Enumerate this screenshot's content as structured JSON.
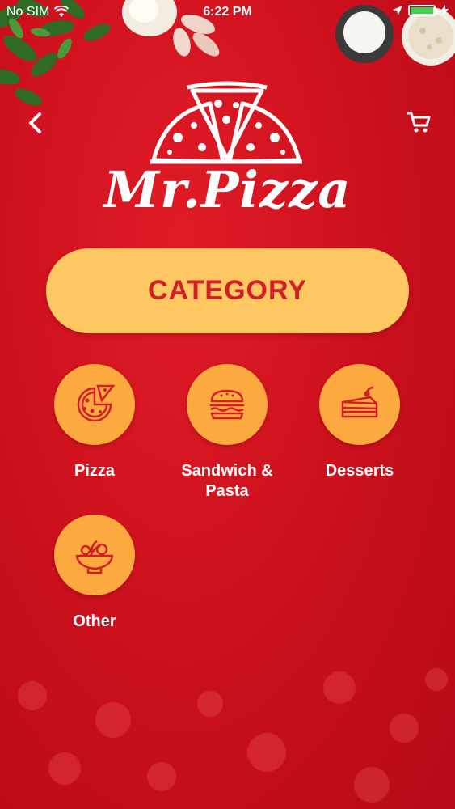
{
  "status_bar": {
    "carrier": "No SIM",
    "time": "6:22 PM",
    "battery_level": 1.0
  },
  "header": {
    "brand": "Mr.Pizza",
    "back_icon": "chevron-left-icon",
    "cart_icon": "cart-icon"
  },
  "category_banner": {
    "label": "CATEGORY"
  },
  "categories": [
    {
      "label": "Pizza",
      "icon": "pizza-icon"
    },
    {
      "label": "Sandwich &\nPasta",
      "icon": "burger-icon"
    },
    {
      "label": "Desserts",
      "icon": "cake-slice-icon"
    },
    {
      "label": "Other",
      "icon": "salad-bowl-icon"
    }
  ],
  "colors": {
    "background": "#d3121f",
    "banner": "#fdc761",
    "banner_text": "#d21e26",
    "category_circle": "#fcaa3f",
    "icon_line": "#d21e26"
  }
}
